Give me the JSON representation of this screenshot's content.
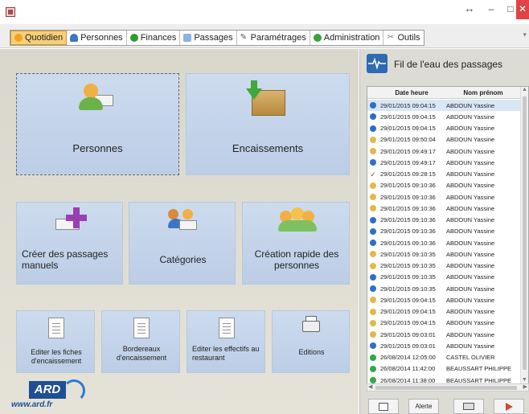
{
  "window": {
    "restore_glyph": "↔",
    "min_glyph": "–",
    "max_glyph": "□",
    "close_glyph": "✕"
  },
  "tabs": [
    {
      "label": "Quotidien",
      "icon": "sun-icon",
      "active": true
    },
    {
      "label": "Personnes",
      "icon": "person-icon"
    },
    {
      "label": "Finances",
      "icon": "money-icon"
    },
    {
      "label": "Passages",
      "icon": "passage-icon"
    },
    {
      "label": "Paramétrages",
      "icon": "settings-icon"
    },
    {
      "label": "Administration",
      "icon": "admin-icon"
    },
    {
      "label": "Outils",
      "icon": "tools-icon"
    }
  ],
  "tiles": {
    "personnes": "Personnes",
    "encaissements": "Encaissements",
    "creer_passages": "Créer des passages manuels",
    "categories": "Catégories",
    "creation_rapide": "Création rapide des personnes",
    "editer_fiches": "Editer les fiches d'encaissement",
    "bordereaux": "Bordereaux d'encaissement",
    "editer_effectifs": "Editer les effectifs au restaurant",
    "editions": "Editions"
  },
  "logo": {
    "text": "ARD",
    "url": "www.ard.fr"
  },
  "panel": {
    "title": "Fil de l'eau des passages",
    "col_date": "Date heure",
    "col_name": "Nom prénom",
    "rows": [
      {
        "status": "blue",
        "date": "29/01/2015 09:04:15",
        "name": "ABDOUN Yassine",
        "selected": true
      },
      {
        "status": "blue",
        "date": "29/01/2015 09:04:15",
        "name": "ABDOUN Yassine"
      },
      {
        "status": "blue",
        "date": "29/01/2015 09:04:15",
        "name": "ABDOUN Yassine"
      },
      {
        "status": "yellow",
        "date": "29/01/2015 09:50:04",
        "name": "ABDOUN Yassine"
      },
      {
        "status": "yellow",
        "date": "29/01/2015 09:49:17",
        "name": "ABDOUN Yassine"
      },
      {
        "status": "blue",
        "date": "29/01/2015 09:49:17",
        "name": "ABDOUN Yassine"
      },
      {
        "status": "check",
        "date": "29/01/2015 09:28:15",
        "name": "ABDOUN Yassine"
      },
      {
        "status": "yellow",
        "date": "29/01/2015 09:10:36",
        "name": "ABDOUN Yassine"
      },
      {
        "status": "yellow",
        "date": "29/01/2015 09:10:36",
        "name": "ABDOUN Yassine"
      },
      {
        "status": "yellow",
        "date": "29/01/2015 09:10:36",
        "name": "ABDOUN Yassine"
      },
      {
        "status": "blue",
        "date": "29/01/2015 09:10:36",
        "name": "ABDOUN Yassine"
      },
      {
        "status": "blue",
        "date": "29/01/2015 09:10:36",
        "name": "ABDOUN Yassine"
      },
      {
        "status": "blue",
        "date": "29/01/2015 09:10:36",
        "name": "ABDOUN Yassine"
      },
      {
        "status": "yellow",
        "date": "29/01/2015 09:10:35",
        "name": "ABDOUN Yassine"
      },
      {
        "status": "yellow",
        "date": "29/01/2015 09:10:35",
        "name": "ABDOUN Yassine"
      },
      {
        "status": "blue",
        "date": "29/01/2015 09:10:35",
        "name": "ABDOUN Yassine"
      },
      {
        "status": "blue",
        "date": "29/01/2015 09:10:35",
        "name": "ABDOUN Yassine"
      },
      {
        "status": "yellow",
        "date": "29/01/2015 09:04:15",
        "name": "ABDOUN Yassine"
      },
      {
        "status": "yellow",
        "date": "29/01/2015 09:04:15",
        "name": "ABDOUN Yassine"
      },
      {
        "status": "yellow",
        "date": "29/01/2015 09:04:15",
        "name": "ABDOUN Yassine"
      },
      {
        "status": "yellow",
        "date": "29/01/2015 09:03:01",
        "name": "ABDOUN Yassine"
      },
      {
        "status": "blue",
        "date": "29/01/2015 09:03:01",
        "name": "ABDOUN Yassine"
      },
      {
        "status": "green",
        "date": "26/08/2014 12:05:00",
        "name": "CASTEL OLIVIER"
      },
      {
        "status": "green",
        "date": "26/08/2014 11:42:00",
        "name": "BEAUSSART PHILIPPE"
      },
      {
        "status": "green",
        "date": "26/08/2014 11:38:00",
        "name": "BEAUSSART PHILIPPE"
      }
    ],
    "btn_alerte": "Alerte"
  },
  "colors": {
    "tab_active": "#f6cf7a",
    "tile": "#c4d3ea",
    "close": "#e04343",
    "panel_icon": "#2f6ab4"
  }
}
